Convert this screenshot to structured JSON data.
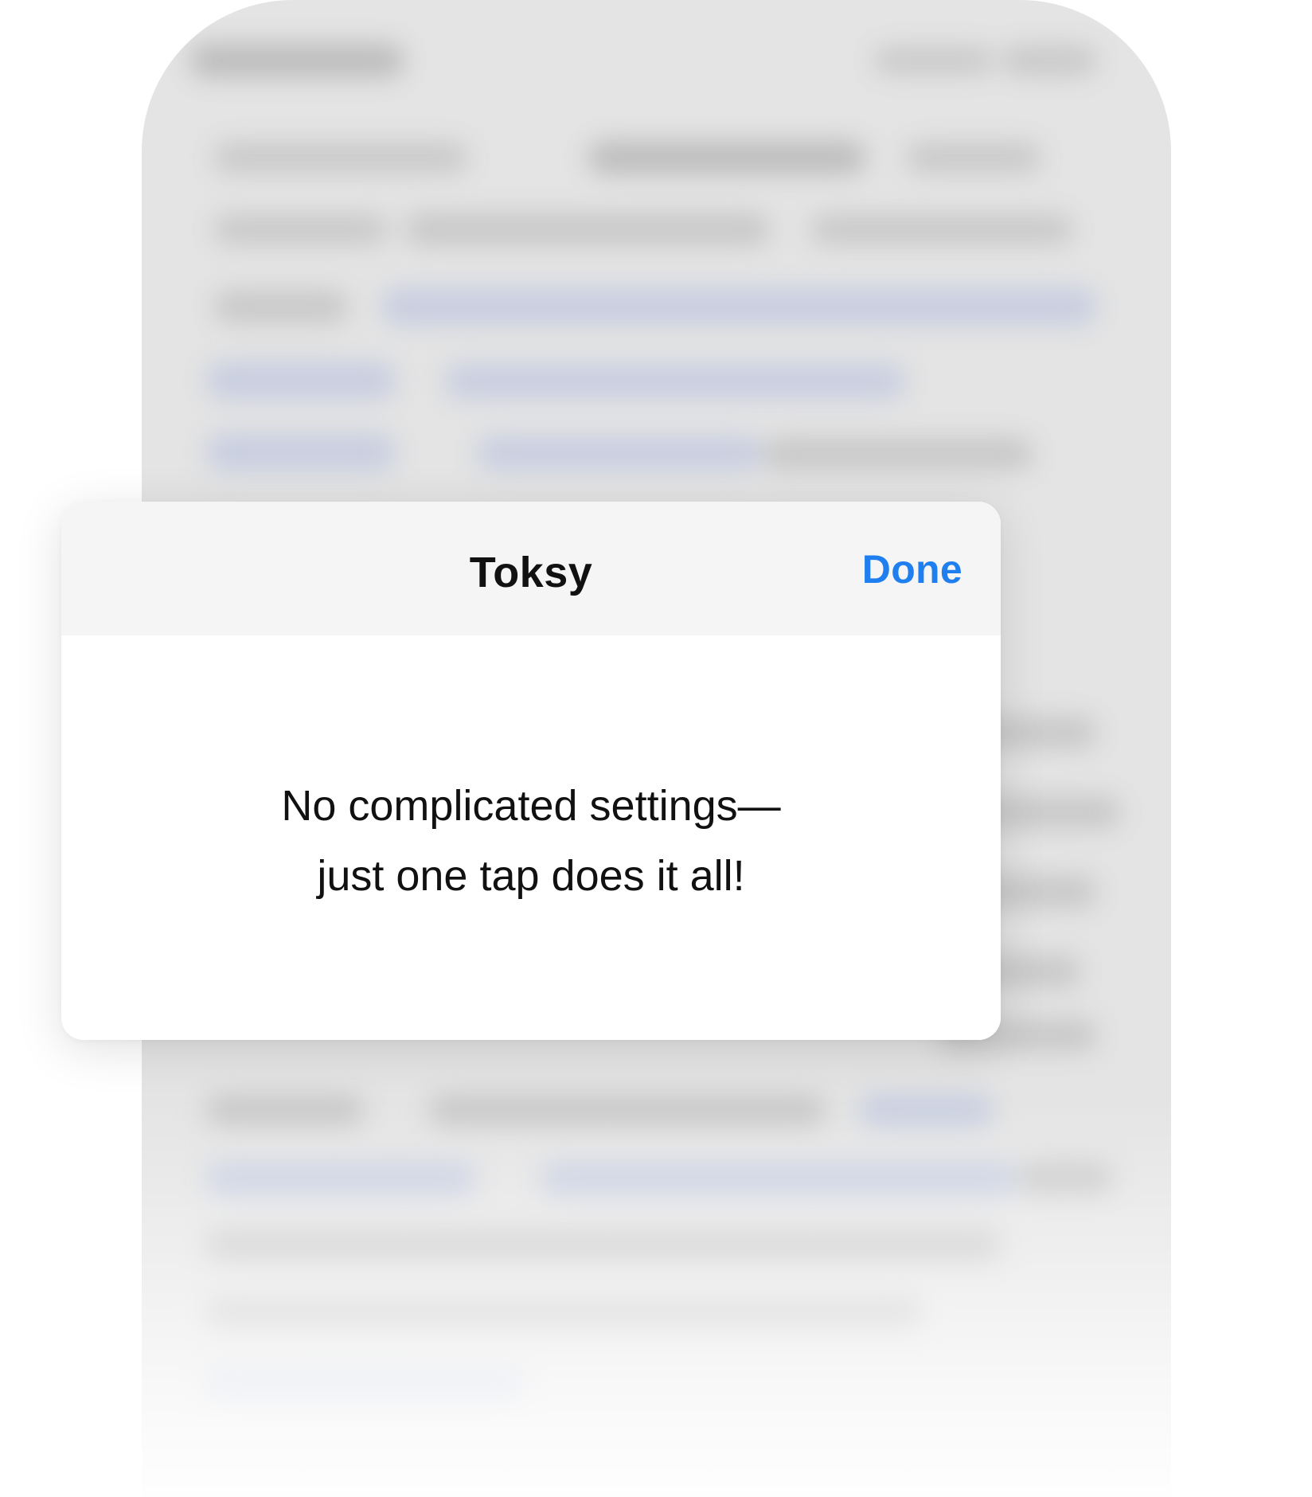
{
  "dialog": {
    "title": "Toksy",
    "done_label": "Done",
    "message_lines": [
      "No complicated settings—",
      "just one tap does it all!"
    ]
  },
  "colors": {
    "accent": "#1f7fee",
    "header_background": "#f5f5f5",
    "text": "#111111",
    "phone_background": "#e4e4e4"
  }
}
